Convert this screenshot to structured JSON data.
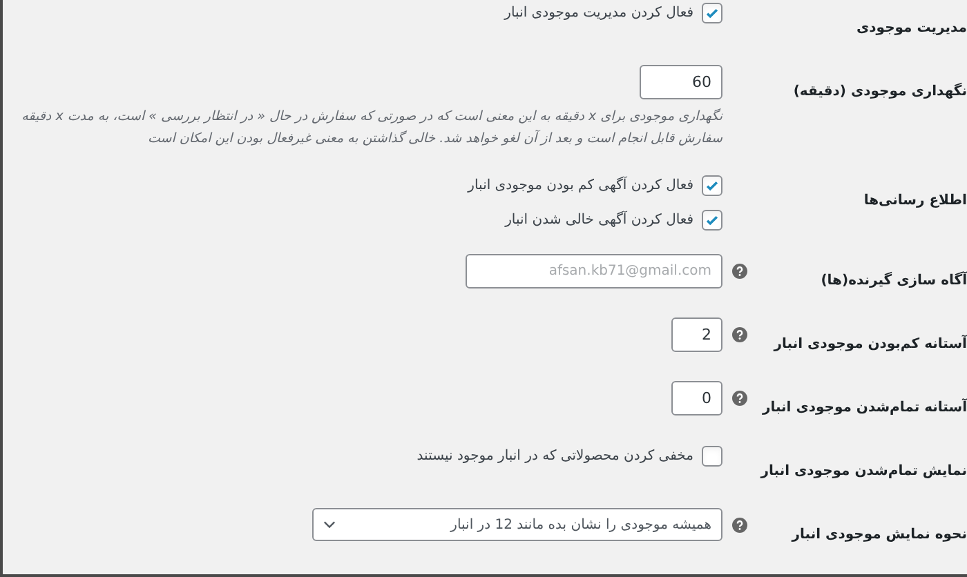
{
  "rows": [
    {
      "kind": "checkboxes",
      "label": "مدیریت موجودی",
      "help": false,
      "options": [
        {
          "label": "فعال کردن مدیریت موجودی انبار",
          "checked": true
        }
      ]
    },
    {
      "kind": "number",
      "label": "نگهداری موجودی (دقیقه)",
      "help": false,
      "value": "60",
      "description": "نگهداری موجودی برای x دقیقه به این معنی است که در صورتی که سفارش در حال « در انتظار بررسی » است، به مدت x دقیقه سفارش قابل انجام است و بعد از آن لغو خواهد شد. خالی گذاشتن به معنی غیرفعال بودن این امکان است"
    },
    {
      "kind": "checkboxes",
      "label": "اطلاع رسانی‌ها",
      "help": false,
      "options": [
        {
          "label": "فعال کردن آگهی کم بودن موجودی انبار",
          "checked": true
        },
        {
          "label": "فعال کردن آگهی خالی شدن انبار",
          "checked": true
        }
      ]
    },
    {
      "kind": "email",
      "label": "آگاه سازی گیرنده(ها)",
      "help": true,
      "placeholder": "afsan.kb71@gmail.com"
    },
    {
      "kind": "number",
      "label": "آستانه کم‌بودن موجودی انبار",
      "help": true,
      "value": "2"
    },
    {
      "kind": "number",
      "label": "آستانه تمام‌شدن موجودی انبار",
      "help": true,
      "value": "0"
    },
    {
      "kind": "checkboxes",
      "label": "نمایش تمام‌شدن موجودی انبار",
      "help": false,
      "options": [
        {
          "label": "مخفی کردن محصولاتی که در انبار موجود نیستند",
          "checked": false
        }
      ]
    },
    {
      "kind": "select",
      "label": "نحوه نمایش موجودی انبار",
      "help": true,
      "value": "همیشه موجودی را نشان بده مانند 12 در انبار"
    }
  ]
}
